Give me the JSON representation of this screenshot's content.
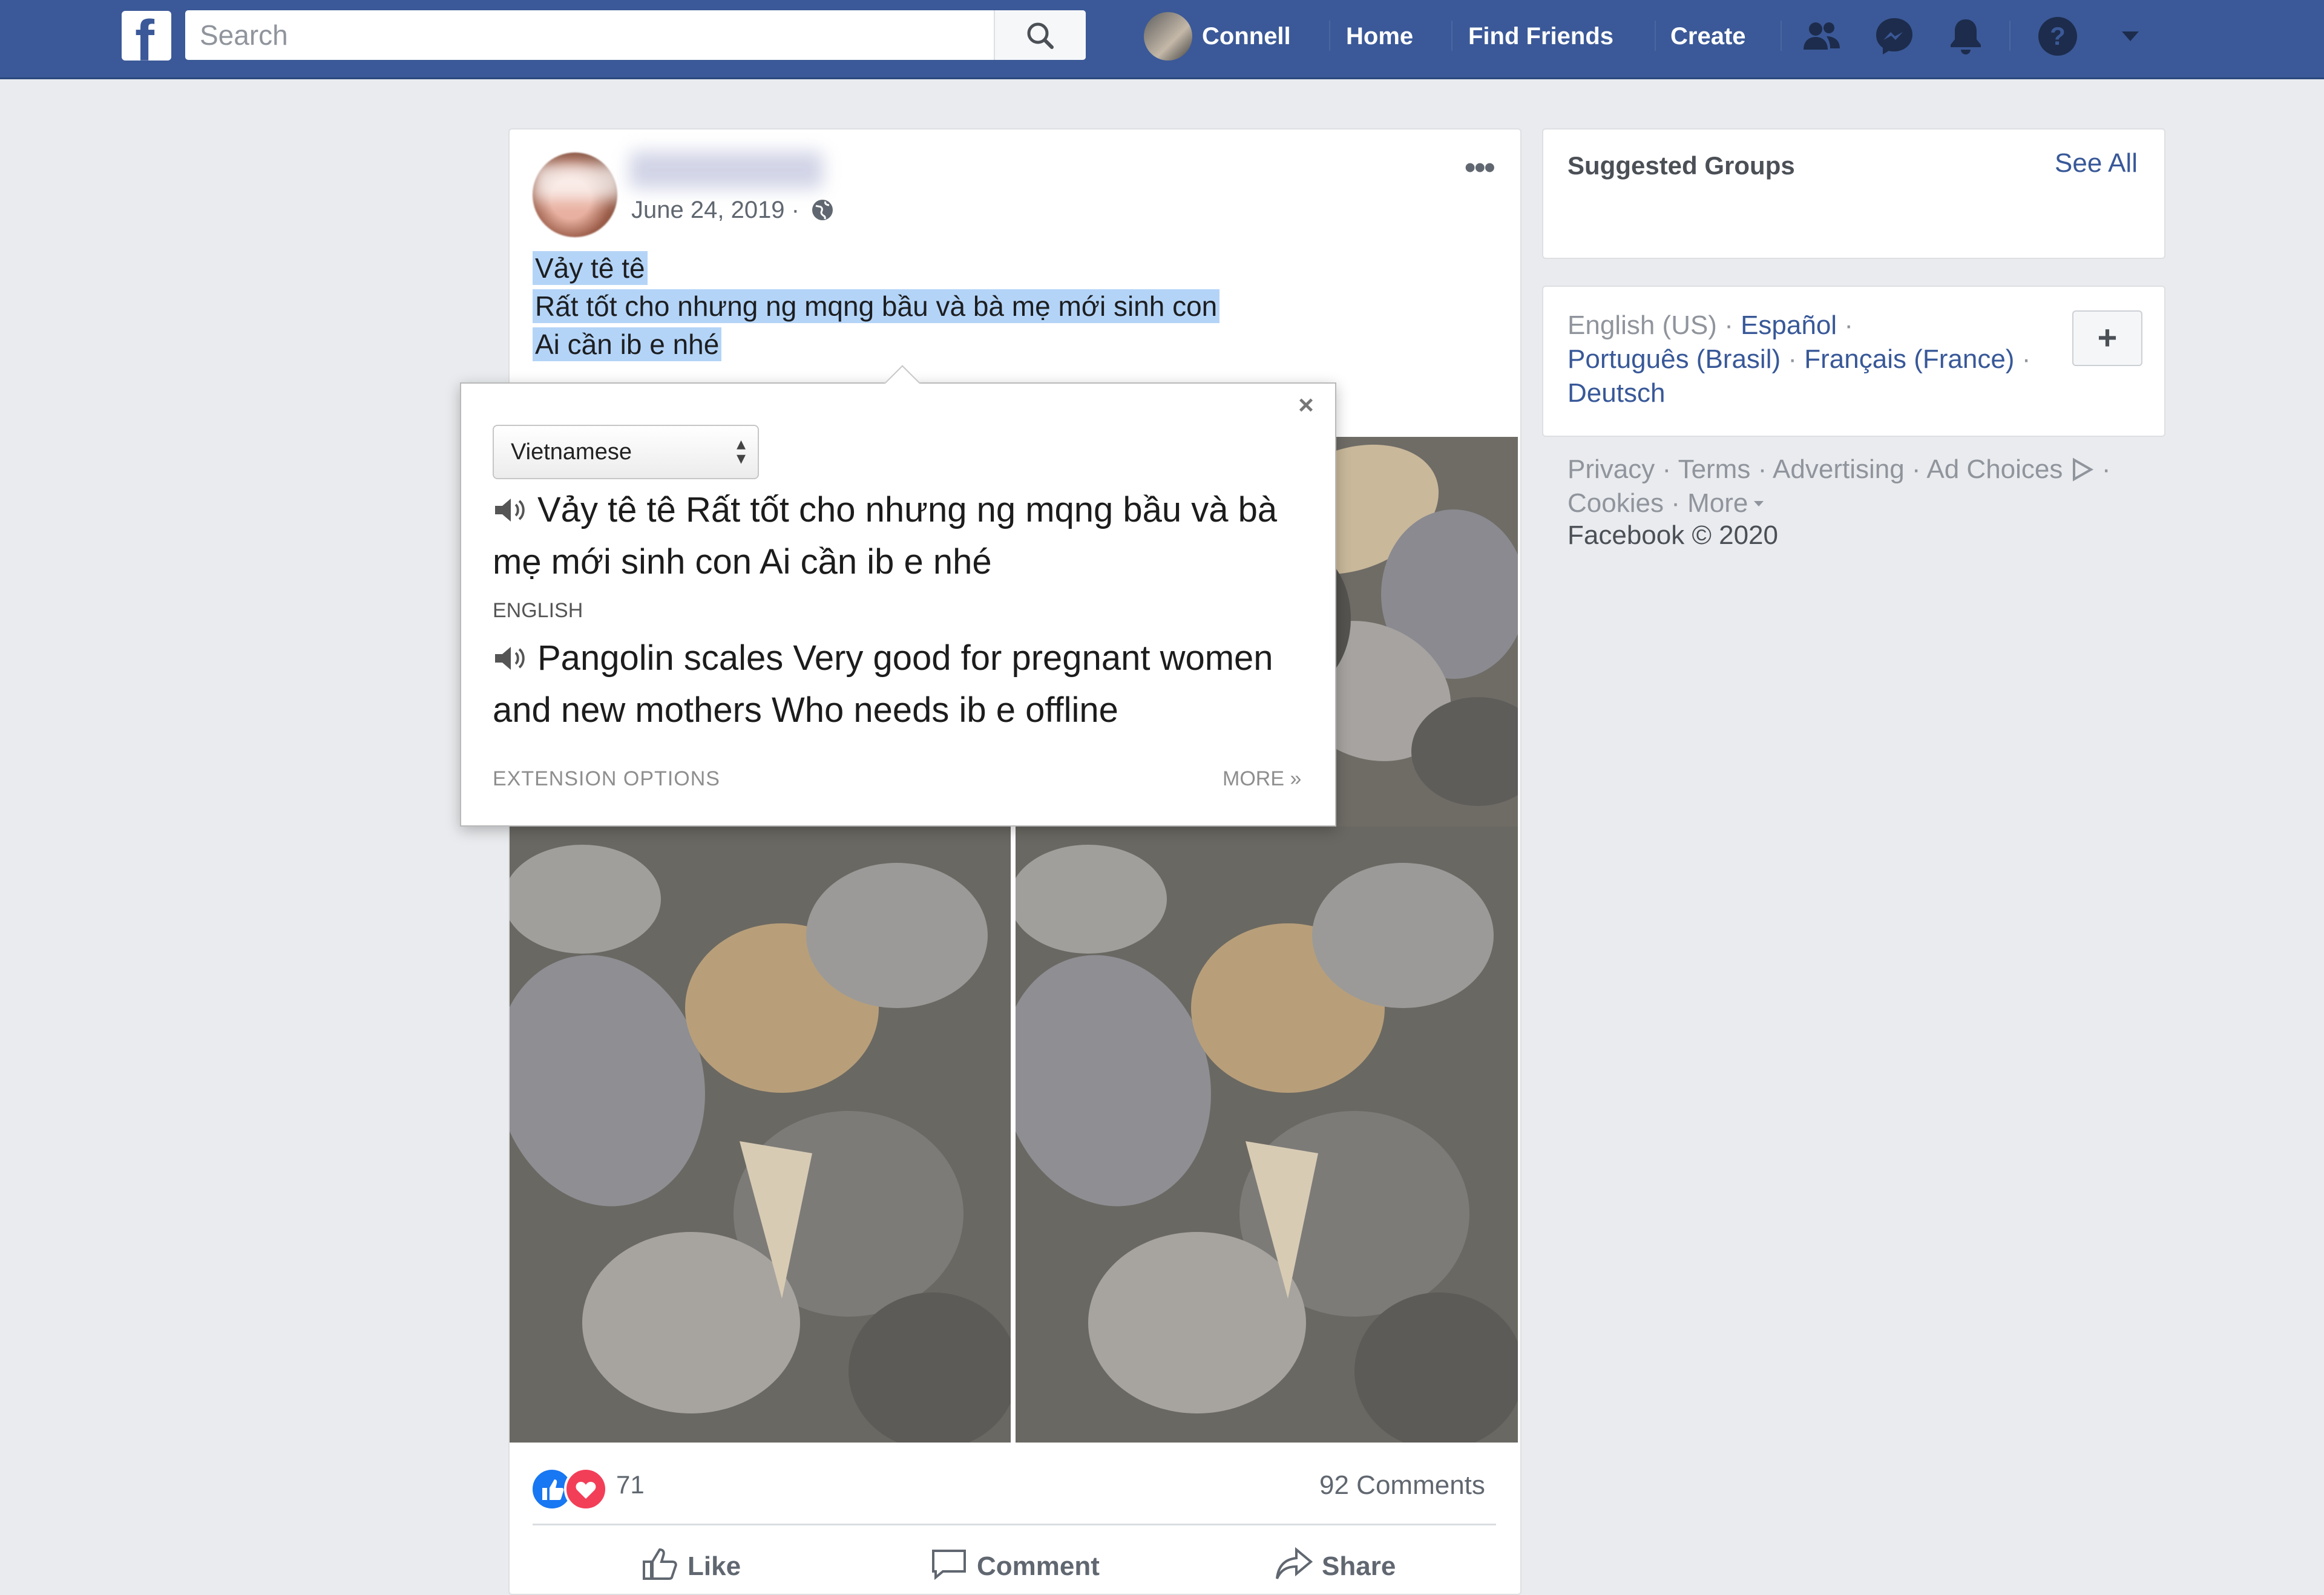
{
  "topbar": {
    "logo": "f",
    "search_placeholder": "Search",
    "user_name": "Connell",
    "nav": {
      "home": "Home",
      "find_friends": "Find Friends",
      "create": "Create"
    },
    "icons": [
      "friends-icon",
      "messenger-icon",
      "notifications-icon",
      "help-icon",
      "caret-down-icon"
    ],
    "brand_color": "#3b5998"
  },
  "post": {
    "date": "June 24, 2019 ·",
    "lines": [
      "Vảy tê tê",
      "Rất tốt cho nhưng ng mqng bầu và bà mẹ mới sinh con",
      "Ai cần ib e nhé"
    ],
    "reaction_count": "71",
    "comments": "92 Comments",
    "actions": {
      "like": "Like",
      "comment": "Comment",
      "share": "Share"
    },
    "selection_color": "#b4d4f7"
  },
  "translate_popup": {
    "close": "×",
    "language_selected": "Vietnamese",
    "source_text": "Vảy tê tê Rất tốt cho nhưng ng mqng bầu và bà mẹ mới sinh con Ai cần ib e nhé",
    "target_label": "ENGLISH",
    "translated_text": "Pangolin scales Very good for pregnant women and new mothers Who needs ib e offline",
    "extension_options": "EXTENSION OPTIONS",
    "more": "MORE »"
  },
  "sidebar": {
    "suggested_groups": "Suggested Groups",
    "see_all": "See All",
    "languages": {
      "current": "English (US) ·",
      "espanol": "Español",
      "sep": "·",
      "portugues": "Português (Brasil)",
      "francais": "Français (France)",
      "deutsch": "Deutsch"
    },
    "add_language": "+",
    "footer": {
      "privacy": "Privacy",
      "terms": "Terms",
      "advertising": "Advertising",
      "ad_choices": "Ad Choices",
      "cookies": "Cookies",
      "more": "More",
      "copyright": "Facebook © 2020"
    }
  }
}
